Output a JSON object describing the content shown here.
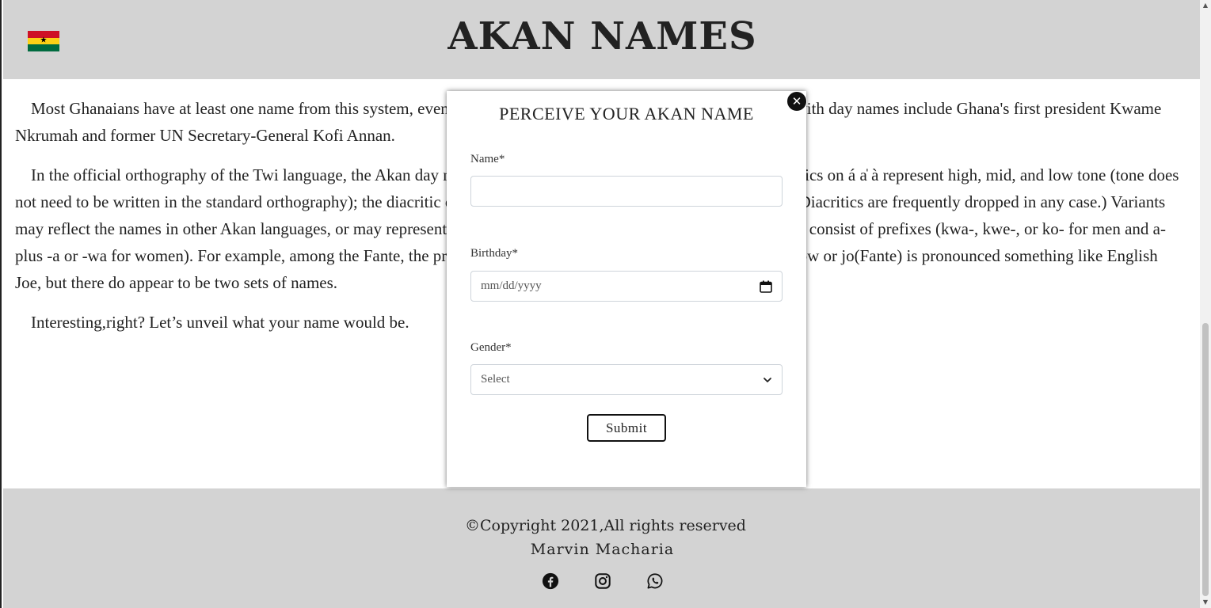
{
  "header": {
    "title": "AKAN NAMES",
    "flag": "ghana-flag"
  },
  "content": {
    "paragraphs": [
      "Most Ghanaians have at least one name from this system, even if they also have a Christian name. Notable figures with day names include Ghana's first president Kwame Nkrumah and former UN Secretary-General Kofi Annan.",
      "In the official orthography of the Twi language, the Akan day names as spoken in Kumasi are as follows. The diacritics on á a̍ à represent high, mid, and low tone (tone does not need to be written in the standard orthography); the diacritic on ạ is used for vowel harmony and can be ignored. (Diacritics are frequently dropped in any case.) Variants may reflect the names in other Akan languages, or may represent different transliteration schemes. The variants mostly consist of prefixes (kwa-, kwe-, or ko- for men and a- plus -a or -wa for women). For example, among the Fante, the prefixes are kwe-, kwa or kwo for men. Jo(Asante), Ekow or jo(Fante) is pronounced something like English Joe, but there do appear to be two sets of names.",
      "Interesting,right? Let’s unveil what your name would be."
    ]
  },
  "modal": {
    "title": "PERCEIVE YOUR AKAN NAME",
    "name_label": "Name*",
    "name_value": "",
    "birthday_label": "Birthday*",
    "birthday_placeholder": "mm/dd/yyyy",
    "gender_label": "Gender*",
    "gender_selected": "Select",
    "submit_label": "Submit",
    "close_icon": "close-icon"
  },
  "footer": {
    "copyright": "©Copyright 2021,All rights reserved",
    "author": "Marvin Macharia",
    "social_icons": [
      "facebook-icon",
      "instagram-icon",
      "whatsapp-icon"
    ]
  }
}
